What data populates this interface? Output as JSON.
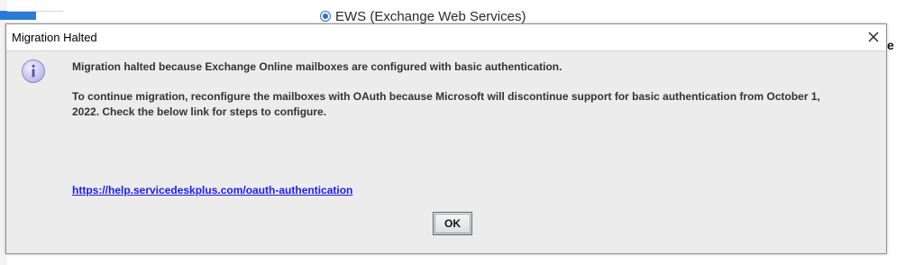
{
  "background": {
    "radio_label": "EWS (Exchange Web Services)",
    "right_fragment": "e"
  },
  "dialog": {
    "title": "Migration Halted",
    "close_glyph": "✕",
    "icon": "info-icon",
    "message_line1": "Migration halted because Exchange Online mailboxes are configured with basic authentication.",
    "message_line2": "To continue migration, reconfigure the mailboxes with OAuth because Microsoft will discontinue support for basic authentication from October 1, 2022. Check the below link for steps to configure.",
    "link_text": "https://help.servicedeskplus.com/oauth-authentication",
    "ok_label": "OK"
  },
  "colors": {
    "accent": "#2d6fd0",
    "link": "#1a1aff",
    "dialog_bg": "#ececec"
  }
}
